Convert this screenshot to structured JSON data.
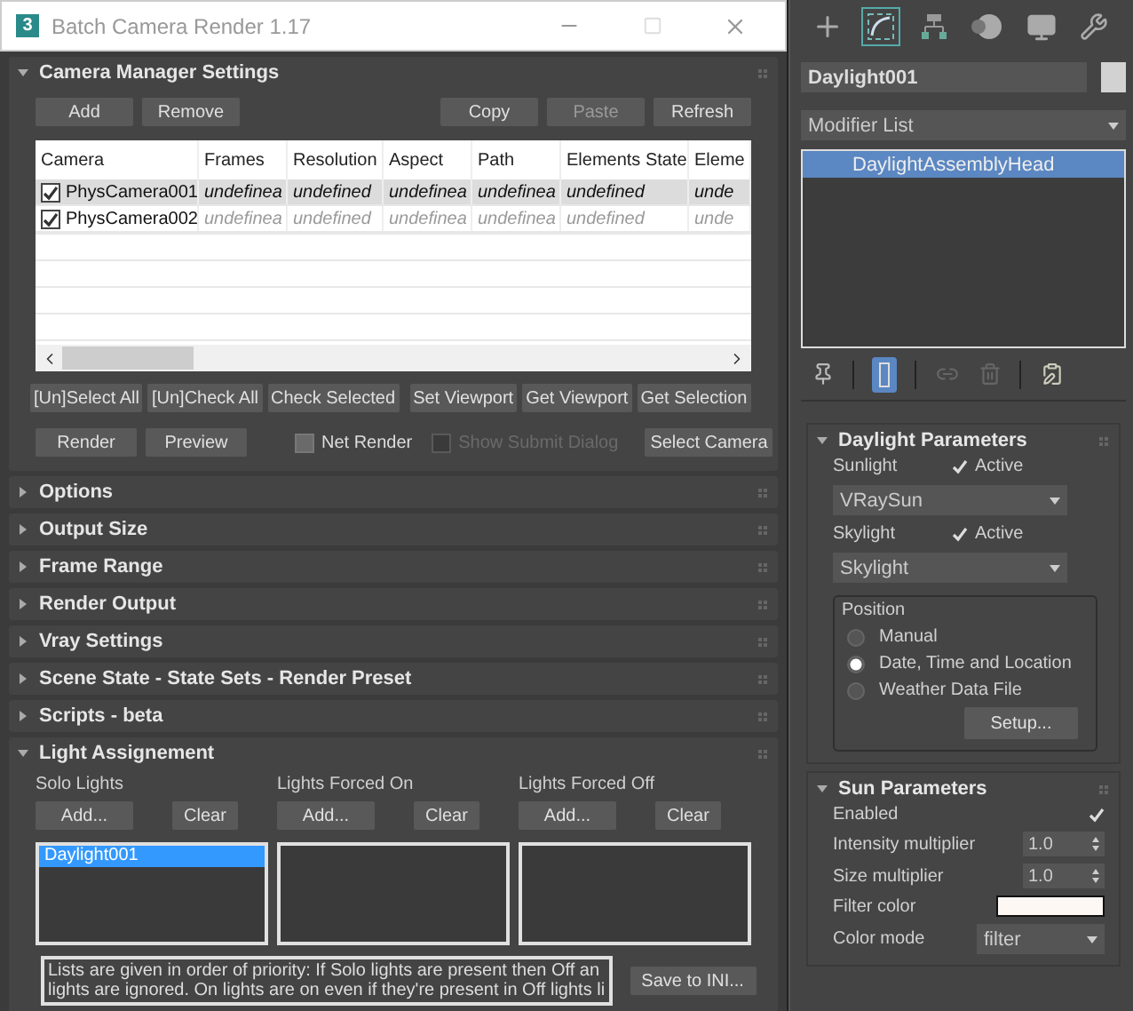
{
  "window": {
    "title": "Batch Camera Render 1.17",
    "app_icon": "3"
  },
  "camera_manager": {
    "title": "Camera Manager Settings",
    "expanded": true,
    "top_buttons": [
      {
        "label": "Add",
        "disabled": false
      },
      {
        "label": "Remove",
        "disabled": false
      },
      {
        "label": "Copy",
        "disabled": false
      },
      {
        "label": "Paste",
        "disabled": true
      },
      {
        "label": "Refresh",
        "disabled": false
      }
    ],
    "table": {
      "columns": [
        "Camera",
        "Frames",
        "Resolution",
        "Aspect",
        "Path",
        "Elements State",
        "Eleme"
      ],
      "rows": [
        {
          "checked": true,
          "selected": true,
          "cells": [
            "PhysCamera001",
            "undefinea",
            "undefined",
            "undefinea",
            "undefinea",
            "undefined",
            "unde"
          ]
        },
        {
          "checked": true,
          "selected": false,
          "cells": [
            "PhysCamera002",
            "undefinea",
            "undefined",
            "undefinea",
            "undefinea",
            "undefined",
            "unde"
          ]
        }
      ]
    },
    "action_buttons": [
      "[Un]Select All",
      "[Un]Check All",
      "Check Selected",
      "Set Viewport",
      "Get Viewport",
      "Get Selection"
    ],
    "bottom_controls": [
      {
        "kind": "button",
        "label": "Render"
      },
      {
        "kind": "button",
        "label": "Preview"
      },
      {
        "kind": "checkbox",
        "label": "Net Render",
        "checked": false,
        "disabled": false
      },
      {
        "kind": "checkbox",
        "label": "Show Submit Dialog",
        "checked": false,
        "disabled": true
      },
      {
        "kind": "button",
        "label": "Select Camera"
      }
    ]
  },
  "rollouts": [
    {
      "title": "Options",
      "expanded": false
    },
    {
      "title": "Output Size",
      "expanded": false
    },
    {
      "title": "Frame Range",
      "expanded": false
    },
    {
      "title": "Render Output",
      "expanded": false
    },
    {
      "title": "Vray Settings",
      "expanded": false
    },
    {
      "title": "Scene State - State Sets - Render Preset",
      "expanded": false
    },
    {
      "title": "Scripts - beta",
      "expanded": false
    }
  ],
  "light_assignment": {
    "title": "Light Assignement",
    "expanded": true,
    "groups": [
      {
        "label": "Solo Lights",
        "buttons": [
          "Add...",
          "Clear"
        ],
        "items": [
          {
            "label": "Daylight001",
            "selected": true
          }
        ]
      },
      {
        "label": "Lights Forced On",
        "buttons": [
          "Add...",
          "Clear"
        ]
      },
      {
        "label": "Lights Forced Off",
        "buttons": [
          "Add...",
          "Clear"
        ]
      }
    ],
    "note_lines": [
      "Lists are given in order of priority: If Solo lights are present then Off an",
      "lights are ignored. On lights are on even if they're present in Off lights li"
    ],
    "save_button": "Save to INI..."
  },
  "command_panel": {
    "tabs": [
      {
        "selected": false
      },
      {
        "selected": true
      },
      {
        "selected": false
      },
      {
        "selected": false
      },
      {
        "selected": false
      },
      {
        "selected": false
      }
    ],
    "object_name": "Daylight001",
    "modifier_list": "Modifier List",
    "stack": [
      {
        "label": "DaylightAssemblyHead",
        "selected": true
      }
    ],
    "stack_tools": [
      {
        "selected": false
      },
      {
        "selected": true
      },
      {
        "selected": false
      },
      {
        "selected": false
      },
      {
        "selected": false
      }
    ],
    "daylight_parameters": {
      "title": "Daylight Parameters",
      "expanded": true,
      "lights": [
        {
          "label": "Sunlight",
          "active_label": "Active",
          "active": true,
          "value": "VRaySun"
        },
        {
          "label": "Skylight",
          "active_label": "Active",
          "active": true,
          "value": "Skylight"
        }
      ],
      "position": {
        "title": "Position",
        "options": [
          {
            "label": "Manual",
            "selected": false
          },
          {
            "label": "Date, Time and Location",
            "selected": true
          },
          {
            "label": "Weather Data File",
            "selected": false
          }
        ]
      },
      "setup_button": "Setup..."
    },
    "sun_parameters": {
      "title": "Sun Parameters",
      "expanded": true,
      "rows": [
        {
          "kind": "checkbox",
          "label": "Enabled",
          "checked": true
        },
        {
          "kind": "spinner",
          "label": "Intensity multiplier",
          "value": "1.0"
        },
        {
          "kind": "spinner",
          "label": "Size multiplier",
          "value": "1.0"
        },
        {
          "kind": "color",
          "label": "Filter color",
          "color": "#fdf8f4"
        },
        {
          "kind": "dropdown",
          "label": "Color mode",
          "value": "filter"
        }
      ]
    }
  }
}
